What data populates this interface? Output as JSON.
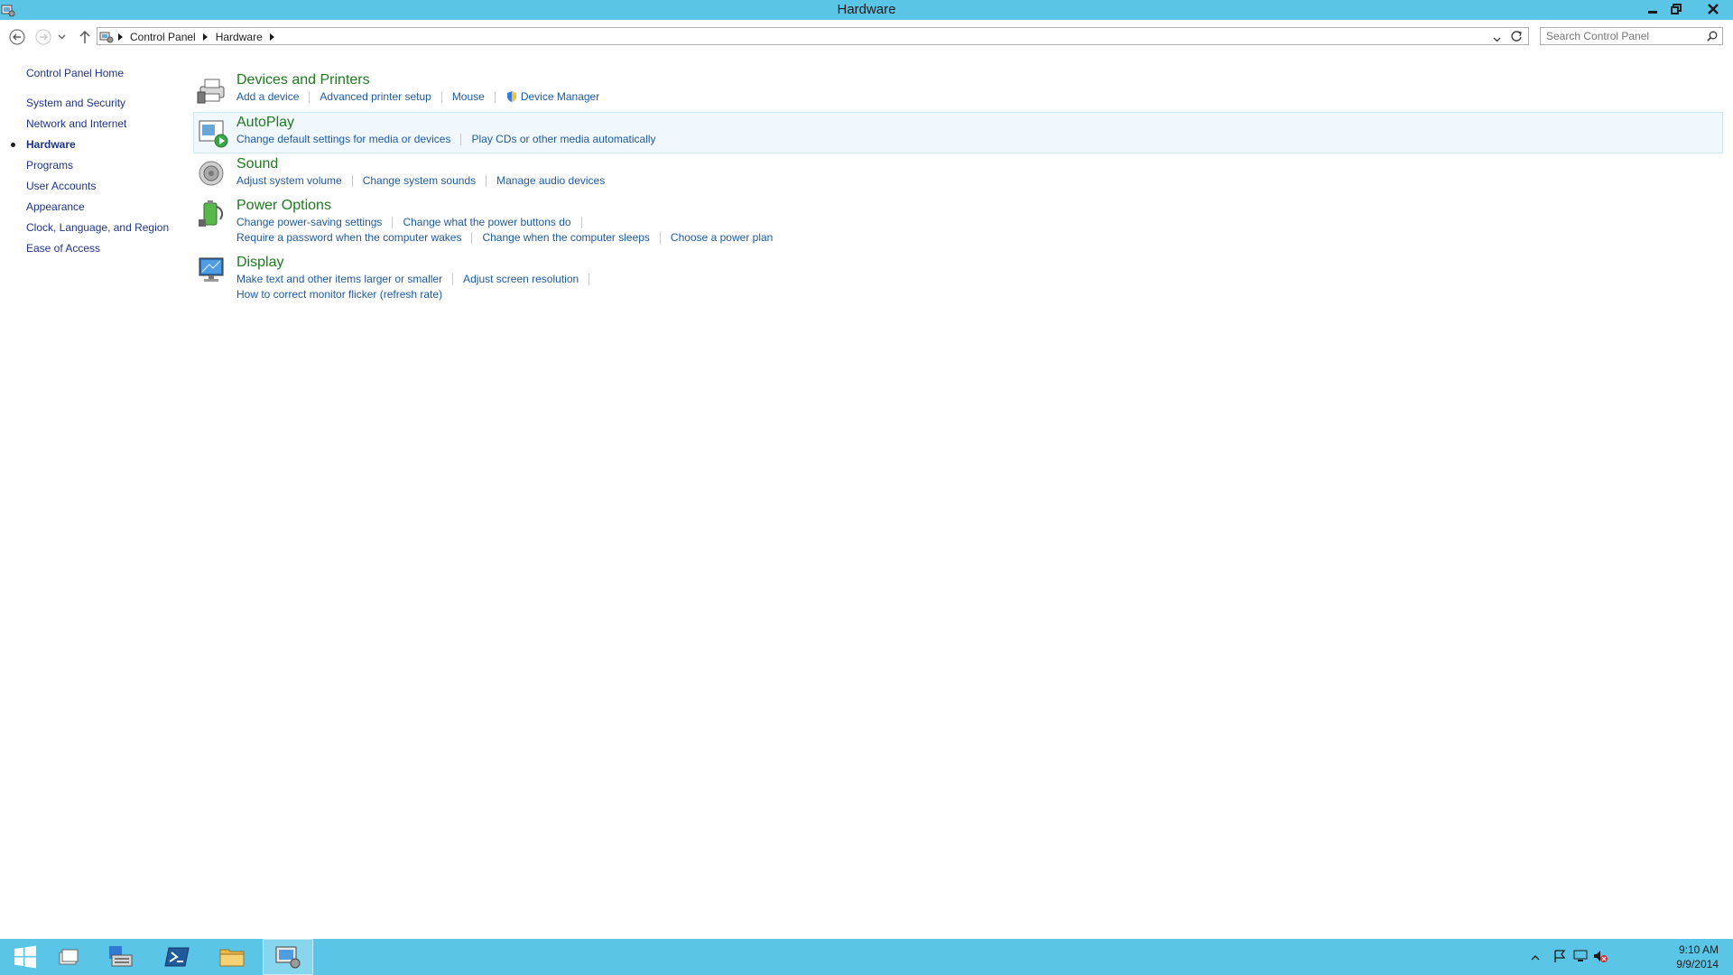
{
  "window": {
    "title": "Hardware"
  },
  "address": {
    "crumbs": [
      "Control Panel",
      "Hardware"
    ]
  },
  "search": {
    "placeholder": "Search Control Panel"
  },
  "nav": {
    "home": "Control Panel Home",
    "items": [
      {
        "label": "System and Security",
        "current": false
      },
      {
        "label": "Network and Internet",
        "current": false
      },
      {
        "label": "Hardware",
        "current": true
      },
      {
        "label": "Programs",
        "current": false
      },
      {
        "label": "User Accounts",
        "current": false
      },
      {
        "label": "Appearance",
        "current": false
      },
      {
        "label": "Clock, Language, and Region",
        "current": false
      },
      {
        "label": "Ease of Access",
        "current": false
      }
    ]
  },
  "categories": [
    {
      "title": "Devices and Printers",
      "icon": "printer-icon",
      "links": [
        [
          "Add a device",
          "Advanced printer setup",
          "Mouse",
          "Device Manager"
        ]
      ]
    },
    {
      "title": "AutoPlay",
      "icon": "autoplay-icon",
      "links": [
        [
          "Change default settings for media or devices",
          "Play CDs or other media automatically"
        ]
      ]
    },
    {
      "title": "Sound",
      "icon": "speaker-icon",
      "links": [
        [
          "Adjust system volume",
          "Change system sounds",
          "Manage audio devices"
        ]
      ]
    },
    {
      "title": "Power Options",
      "icon": "battery-icon",
      "links": [
        [
          "Change power-saving settings",
          "Change what the power buttons do"
        ],
        [
          "Require a password when the computer wakes",
          "Change when the computer sleeps",
          "Choose a power plan"
        ]
      ]
    },
    {
      "title": "Display",
      "icon": "monitor-icon",
      "links": [
        [
          "Make text and other items larger or smaller",
          "Adjust screen resolution"
        ],
        [
          "How to correct monitor flicker (refresh rate)"
        ]
      ]
    }
  ],
  "taskbar": {
    "clock": {
      "time": "9:10 AM",
      "date": "9/9/2014"
    }
  },
  "colors": {
    "titlebar": "#5bc5e8",
    "heading": "#1e7a1e",
    "link": "#1e5aa0",
    "nav_link": "#1e3287"
  }
}
